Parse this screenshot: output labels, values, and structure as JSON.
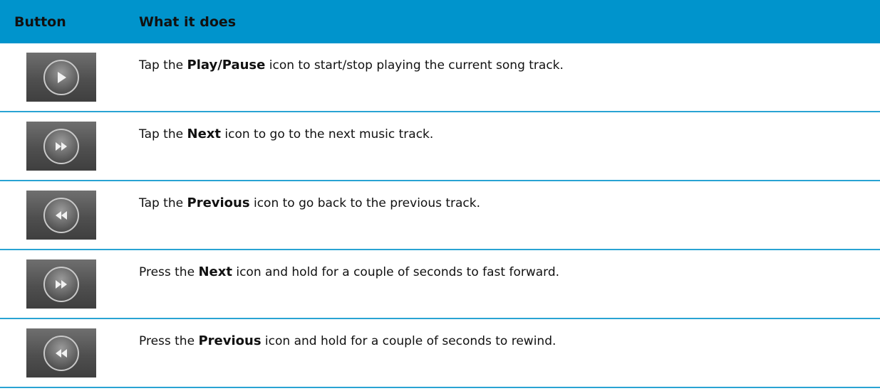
{
  "header": {
    "col_button": "Button",
    "col_desc": "What it does"
  },
  "rows": [
    {
      "icon": "play-icon",
      "pre": "Tap the ",
      "bold": "Play/Pause",
      "post": " icon to start/stop playing the current song track."
    },
    {
      "icon": "next-icon",
      "pre": "Tap the ",
      "bold": "Next",
      "post": " icon to go to the next music track."
    },
    {
      "icon": "previous-icon",
      "pre": "Tap the ",
      "bold": "Previous",
      "post": " icon to go back to the previous track."
    },
    {
      "icon": "next-icon",
      "pre": "Press the ",
      "bold": "Next",
      "post": " icon and hold for a couple of seconds to fast forward."
    },
    {
      "icon": "previous-icon",
      "pre": "Press the ",
      "bold": "Previous",
      "post": " icon and hold for a couple of seconds to rewind."
    }
  ],
  "colors": {
    "header_bg": "#0094cc",
    "divider": "#29a3d3"
  }
}
